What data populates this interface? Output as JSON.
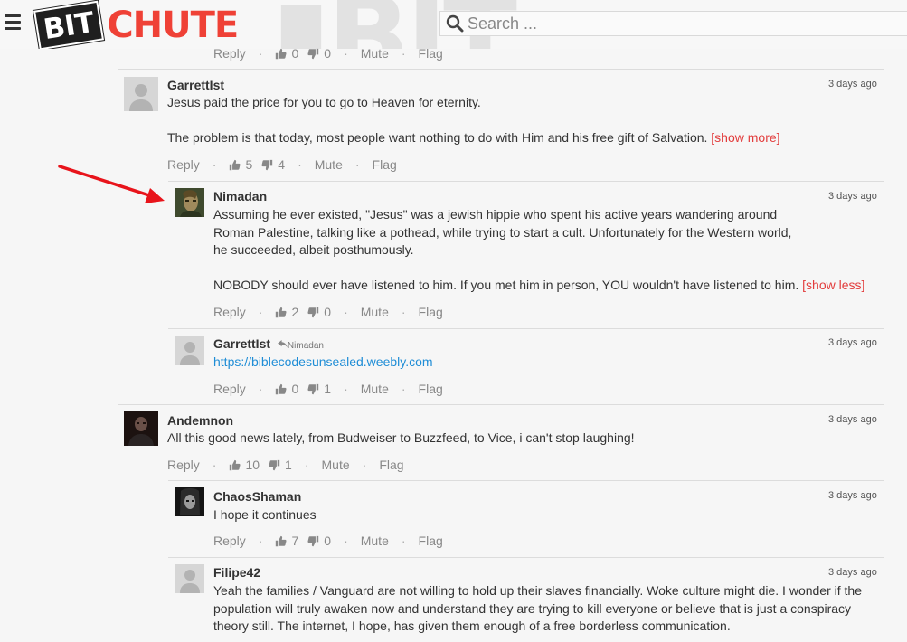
{
  "header": {
    "logo_bit": "BIT",
    "logo_chute": "CHUTE",
    "search_placeholder": "Search ..."
  },
  "top_partial": {
    "reply": "Reply",
    "likes": "0",
    "dislikes": "0",
    "mute": "Mute",
    "flag": "Flag"
  },
  "comments": [
    {
      "author": "GarrettIst",
      "time": "3 days ago",
      "line1": "Jesus paid the price for you to go to Heaven for eternity.",
      "line2": "The problem is that today, most people want nothing to do with Him and his free gift of Salvation.",
      "more": "[show more]",
      "reply": "Reply",
      "likes": "5",
      "dislikes": "4",
      "mute": "Mute",
      "flag": "Flag"
    },
    {
      "author": "Nimadan",
      "time": "3 days ago",
      "lines": [
        "Assuming he ever existed, \"Jesus\" was a jewish hippie who spent his active years wandering around",
        "Roman Palestine, talking like a pothead, while trying to start a cult. Unfortunately for the Western world,",
        "he succeeded, albeit posthumously."
      ],
      "line_last": "NOBODY should ever have listened to him. If you met him in person, YOU wouldn't have listened to him.",
      "more": "[show less]",
      "reply": "Reply",
      "likes": "2",
      "dislikes": "0",
      "mute": "Mute",
      "flag": "Flag"
    },
    {
      "author": "GarrettIst",
      "reply_to": "Nimadan",
      "time": "3 days ago",
      "link": "https://biblecodesunsealed.weebly.com",
      "reply": "Reply",
      "likes": "0",
      "dislikes": "1",
      "mute": "Mute",
      "flag": "Flag"
    },
    {
      "author": "Andemnon",
      "time": "3 days ago",
      "text": "All this good news lately, from Budweiser to Buzzfeed, to Vice, i can't stop laughing!",
      "reply": "Reply",
      "likes": "10",
      "dislikes": "1",
      "mute": "Mute",
      "flag": "Flag"
    },
    {
      "author": "ChaosShaman",
      "time": "3 days ago",
      "text": "I hope it continues",
      "reply": "Reply",
      "likes": "7",
      "dislikes": "0",
      "mute": "Mute",
      "flag": "Flag"
    },
    {
      "author": "Filipe42",
      "time": "3 days ago",
      "lines": [
        "Yeah the families / Vanguard are not willing to hold up their slaves financially. Woke culture might die. I wonder if the",
        "population will truly awaken now and understand they are trying to kill everyone or believe that is just a conspiracy",
        "theory still. The internet, I hope, has given them enough of a free borderless communication."
      ]
    }
  ],
  "colors": {
    "accent": "#ef4136",
    "link": "#1f8dd6",
    "annotation_arrow": "#e8141b"
  },
  "icons": [
    "hamburger-menu-icon",
    "search-icon",
    "thumbs-up-icon",
    "thumbs-down-icon",
    "reply-arrow-icon",
    "default-avatar-icon"
  ]
}
